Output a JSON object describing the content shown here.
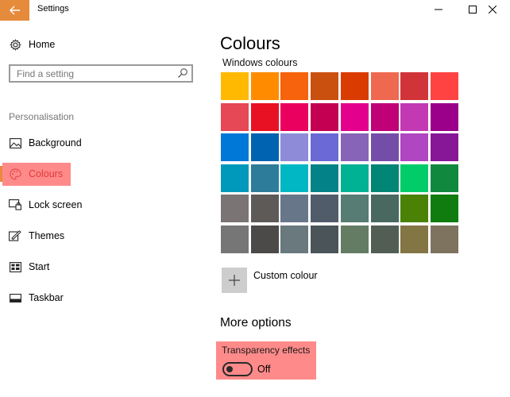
{
  "window": {
    "title": "Settings",
    "accent": "#e68b3b"
  },
  "sidebar": {
    "home_label": "Home",
    "search_placeholder": "Find a setting",
    "section_label": "Personalisation",
    "items": [
      {
        "label": "Background",
        "icon": "picture-icon"
      },
      {
        "label": "Colours",
        "icon": "palette-icon",
        "selected": true
      },
      {
        "label": "Lock screen",
        "icon": "lock-screen-icon"
      },
      {
        "label": "Themes",
        "icon": "themes-brush-icon"
      },
      {
        "label": "Start",
        "icon": "start-icon"
      },
      {
        "label": "Taskbar",
        "icon": "taskbar-icon"
      }
    ],
    "highlight_color": "#ff8a8a"
  },
  "main": {
    "title": "Colours",
    "subheading": "Windows colours",
    "swatch_rows": [
      [
        "#ffb900",
        "#ff8c00",
        "#f7630c",
        "#ca5010",
        "#da3b01",
        "#ef6950",
        "#d13438",
        "#ff4343"
      ],
      [
        "#e74856",
        "#e81123",
        "#ea005e",
        "#c30052",
        "#e3008c",
        "#bf0077",
        "#c239b3",
        "#9a0089"
      ],
      [
        "#0078d7",
        "#0063b1",
        "#8e8cd8",
        "#6b69d6",
        "#8764b8",
        "#744da9",
        "#b146c2",
        "#881798"
      ],
      [
        "#0099bc",
        "#2d7d9a",
        "#00b7c3",
        "#038387",
        "#00b294",
        "#018574",
        "#00cc6a",
        "#10893e"
      ],
      [
        "#7a7574",
        "#5d5a58",
        "#68768a",
        "#515c6b",
        "#567c73",
        "#486860",
        "#498205",
        "#107c10"
      ],
      [
        "#767676",
        "#4c4a48",
        "#69797e",
        "#4a5459",
        "#647c64",
        "#525e54",
        "#847545",
        "#7e735f"
      ]
    ],
    "custom_colour_label": "Custom colour",
    "more_options_title": "More options",
    "transparency_label": "Transparency effects",
    "transparency_state": "Off"
  }
}
